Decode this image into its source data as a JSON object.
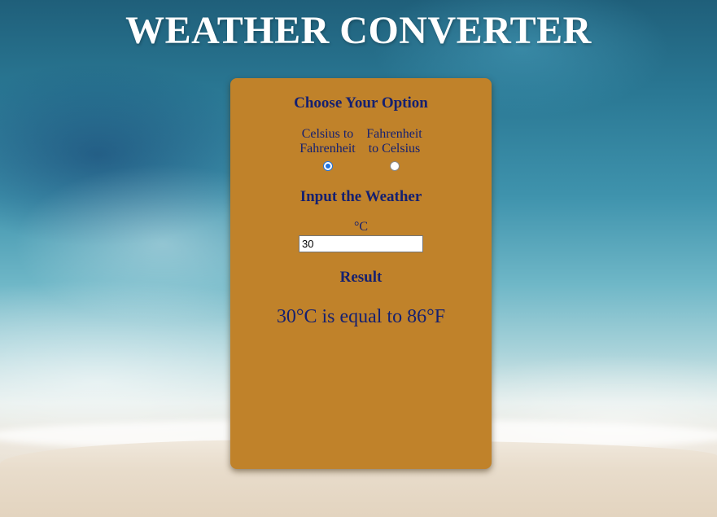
{
  "page": {
    "title": "WEATHER CONVERTER"
  },
  "converter": {
    "choose_title": "Choose Your Option",
    "options": [
      {
        "label_line1": "Celsius to",
        "label_line2": "Fahrenheit",
        "selected": true
      },
      {
        "label_line1": "Fahrenheit",
        "label_line2": "to Celsius",
        "selected": false
      }
    ],
    "input_title": "Input the Weather",
    "unit": "°C",
    "input_value": "30",
    "result_title": "Result",
    "result_text": "30°C is equal to 86°F"
  },
  "colors": {
    "card_background": "#c0822a",
    "text": "#152070",
    "title": "#ffffff",
    "radio_accent": "#1f73e0"
  }
}
